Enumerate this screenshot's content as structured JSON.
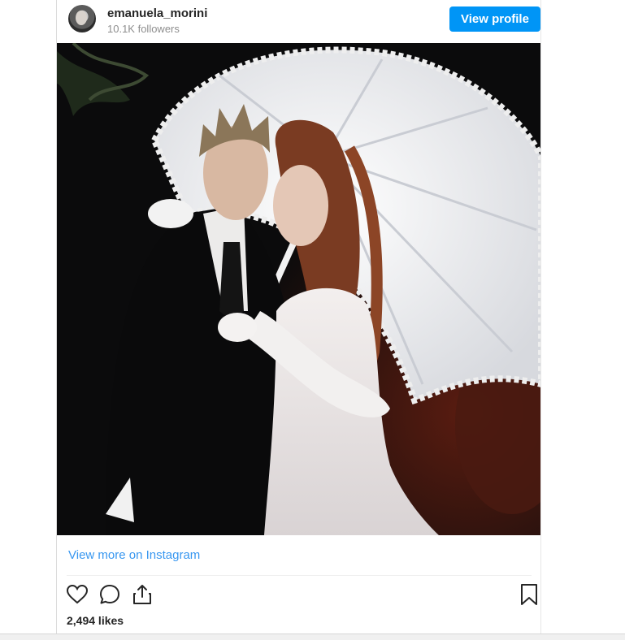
{
  "header": {
    "username": "emanuela_morini",
    "followers": "10.1K followers",
    "view_profile_label": "View profile"
  },
  "post": {
    "view_more_label": "View more on Instagram",
    "likes": "2,494 likes"
  },
  "colors": {
    "accent": "#0095f6",
    "link": "#3897f0",
    "text": "#262626",
    "muted": "#8e8e8e"
  },
  "icons": [
    "heart-icon",
    "comment-icon",
    "share-icon",
    "bookmark-icon"
  ]
}
